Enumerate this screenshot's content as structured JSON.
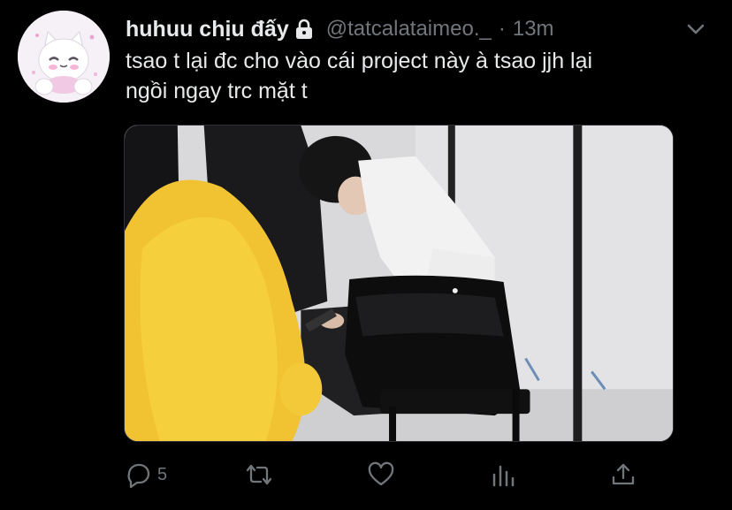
{
  "tweet": {
    "display_name": "huhuu chịu đấy",
    "handle": "@tatcalataimeo._",
    "separator": "·",
    "time": "13m",
    "text_line1": "tsao t lại đc cho vào cái project này à tsao jjh lại",
    "text_line2": "ngồi ngay trc mặt t",
    "avatar_icon": "cat-avatar-icon",
    "media_alt": "photo-of-person-sitting-on-black-chair"
  },
  "actions": {
    "reply_count": "5",
    "retweet_count": "",
    "like_count": ""
  },
  "colors": {
    "background": "#000000",
    "text_primary": "#e7e9ea",
    "text_secondary": "#71767b"
  }
}
